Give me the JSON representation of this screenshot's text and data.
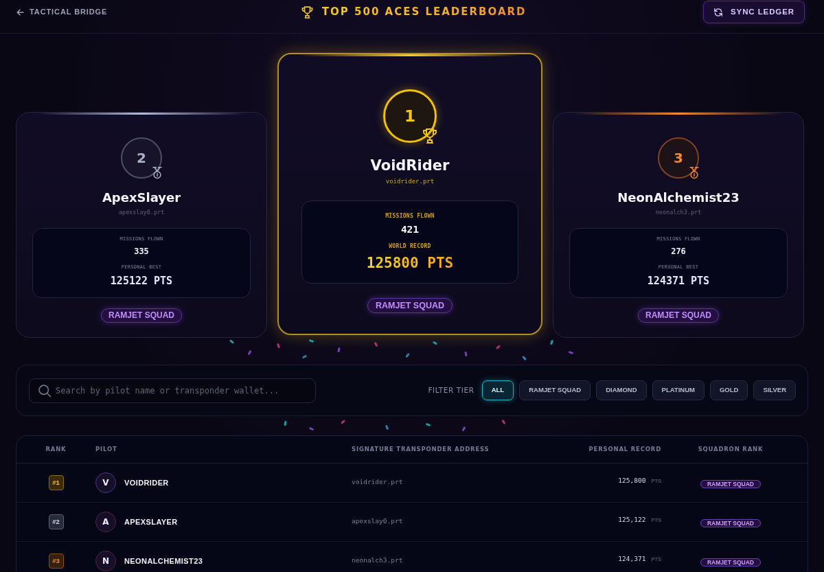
{
  "header": {
    "back_link": "TACTICAL BRIDGE",
    "title": "TOP 500 ACES LEADERBOARD",
    "sync_button": "SYNC LEDGER"
  },
  "podium": [
    {
      "kind": "silver",
      "rank": "2",
      "name": "ApexSlayer",
      "handle": "apexslay0.prt",
      "stats": [
        {
          "label": "MISSIONS FLOWN",
          "value": "335"
        },
        {
          "label": "PERSONAL BEST",
          "value": "125122 PTS"
        }
      ],
      "squad": "RAMJET SQUAD"
    },
    {
      "kind": "gold",
      "rank": "1",
      "name": "VoidRider",
      "handle": "voidrider.prt",
      "stats": [
        {
          "label": "MISSIONS FLOWN",
          "value": "421"
        },
        {
          "label": "WORLD RECORD",
          "value": "125800 PTS"
        }
      ],
      "squad": "RAMJET SQUAD"
    },
    {
      "kind": "bronze",
      "rank": "3",
      "name": "NeonAlchemist23",
      "handle": "neonalch3.prt",
      "stats": [
        {
          "label": "MISSIONS FLOWN",
          "value": "276"
        },
        {
          "label": "PERSONAL BEST",
          "value": "124371 PTS"
        }
      ],
      "squad": "RAMJET SQUAD"
    }
  ],
  "filter": {
    "search": {
      "placeholder": "Search by pilot name or transponder wallet..."
    },
    "label": "FILTER TIER",
    "tiers": [
      {
        "label": "ALL",
        "selected": true
      },
      {
        "label": "RAMJET SQUAD",
        "selected": false
      },
      {
        "label": "DIAMOND",
        "selected": false
      },
      {
        "label": "PLATINUM",
        "selected": false
      },
      {
        "label": "GOLD",
        "selected": false
      },
      {
        "label": "SILVER",
        "selected": false
      }
    ]
  },
  "table": {
    "columns": [
      "RANK",
      "PILOT",
      "SIGNATURE TRANSPONDER ADDRESS",
      "PERSONAL RECORD",
      "SQUADRON RANK"
    ],
    "rows": [
      {
        "kind": "gold",
        "rank": "#1",
        "initial": "V",
        "color": "#4e3387",
        "pilot": "VOIDRIDER",
        "address": "voidrider.prt",
        "record": "125,800",
        "unit": "PTS",
        "squad": "RAMJET SQUAD"
      },
      {
        "kind": "silver",
        "rank": "#2",
        "initial": "A",
        "color": "#5a2342",
        "pilot": "APEXSLAYER",
        "address": "apexslay0.prt",
        "record": "125,122",
        "unit": "PTS",
        "squad": "RAMJET SQUAD"
      },
      {
        "kind": "bronze",
        "rank": "#3",
        "initial": "N",
        "color": "#5a2342",
        "pilot": "NEONALCHEMIST23",
        "address": "neonalch3.prt",
        "record": "124,371",
        "unit": "PTS",
        "squad": "RAMJET SQUAD"
      }
    ]
  }
}
